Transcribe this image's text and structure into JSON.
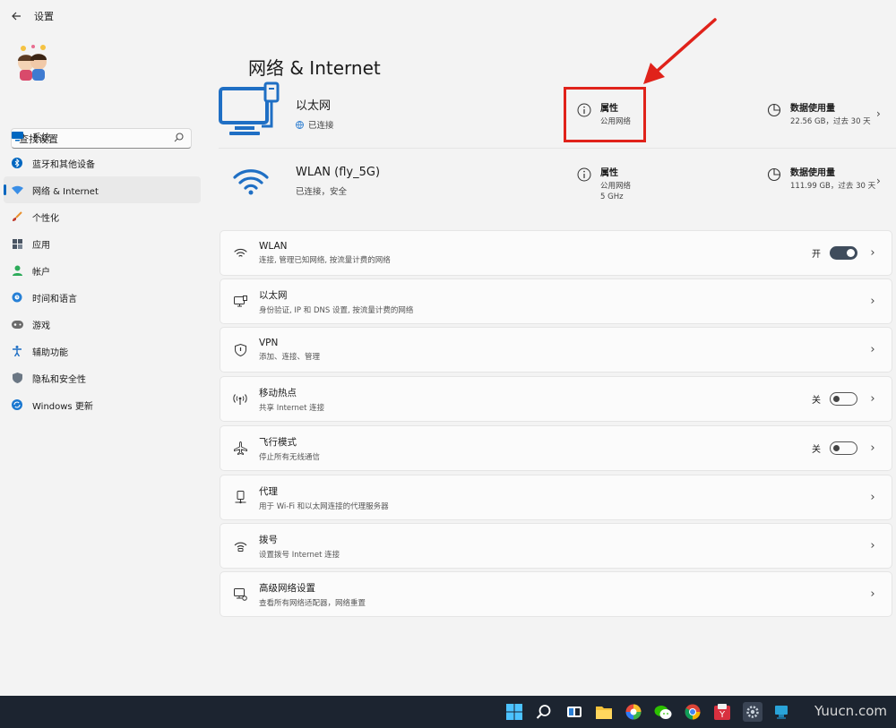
{
  "window": {
    "title": "设置",
    "back_icon": "arrow-left-icon"
  },
  "sidebar": {
    "search_placeholder": "查找设置",
    "items": [
      {
        "label": "系统",
        "icon": "monitor-icon",
        "color": "#0067c0"
      },
      {
        "label": "蓝牙和其他设备",
        "icon": "bluetooth-icon",
        "color": "#0067c0"
      },
      {
        "label": "网络 & Internet",
        "icon": "wifi-diamond-icon",
        "color": "#3a8ee6",
        "active": true
      },
      {
        "label": "个性化",
        "icon": "brush-icon",
        "color": "#e8912d"
      },
      {
        "label": "应用",
        "icon": "apps-icon",
        "color": "#4a5563"
      },
      {
        "label": "帐户",
        "icon": "person-icon",
        "color": "#2dab5a"
      },
      {
        "label": "时间和语言",
        "icon": "globe-clock-icon",
        "color": "#2680d6"
      },
      {
        "label": "游戏",
        "icon": "gamepad-icon",
        "color": "#6b6b6b"
      },
      {
        "label": "辅助功能",
        "icon": "accessibility-icon",
        "color": "#1f6fc4"
      },
      {
        "label": "隐私和安全性",
        "icon": "shield-icon",
        "color": "#6b7784"
      },
      {
        "label": "Windows 更新",
        "icon": "update-icon",
        "color": "#1b78d0"
      }
    ]
  },
  "main": {
    "title": "网络 & Internet",
    "ethernet": {
      "name": "以太网",
      "status": "已连接",
      "properties_title": "属性",
      "properties_sub": "公用网络",
      "usage_title": "数据使用量",
      "usage_sub": "22.56 GB，过去 30 天"
    },
    "wlan": {
      "name": "WLAN (fly_5G)",
      "status": "已连接，安全",
      "properties_title": "属性",
      "properties_sub1": "公用网络",
      "properties_sub2": "5 GHz",
      "usage_title": "数据使用量",
      "usage_sub": "111.99 GB，过去 30 天"
    },
    "cards": [
      {
        "title": "WLAN",
        "desc": "连接, 管理已知网络, 按流量计费的网络",
        "icon": "wifi-icon",
        "toggle": "开",
        "toggle_on": true
      },
      {
        "title": "以太网",
        "desc": "身份验证, IP 和 DNS 设置, 按流量计费的网络",
        "icon": "ethernet-icon"
      },
      {
        "title": "VPN",
        "desc": "添加、连接、管理",
        "icon": "vpn-shield-icon"
      },
      {
        "title": "移动热点",
        "desc": "共享 Internet 连接",
        "icon": "hotspot-icon",
        "toggle": "关",
        "toggle_on": false
      },
      {
        "title": "飞行模式",
        "desc": "停止所有无线通信",
        "icon": "airplane-icon",
        "toggle": "关",
        "toggle_on": false
      },
      {
        "title": "代理",
        "desc": "用于 Wi-Fi 和以太网连接的代理服务器",
        "icon": "proxy-icon"
      },
      {
        "title": "拨号",
        "desc": "设置拨号 Internet 连接",
        "icon": "dialup-icon"
      },
      {
        "title": "高级网络设置",
        "desc": "查看所有网络适配器，网络重置",
        "icon": "advanced-network-icon"
      }
    ]
  },
  "annotation": {
    "color": "#e0221a"
  },
  "taskbar": {
    "watermark": "Yuucn.com"
  }
}
